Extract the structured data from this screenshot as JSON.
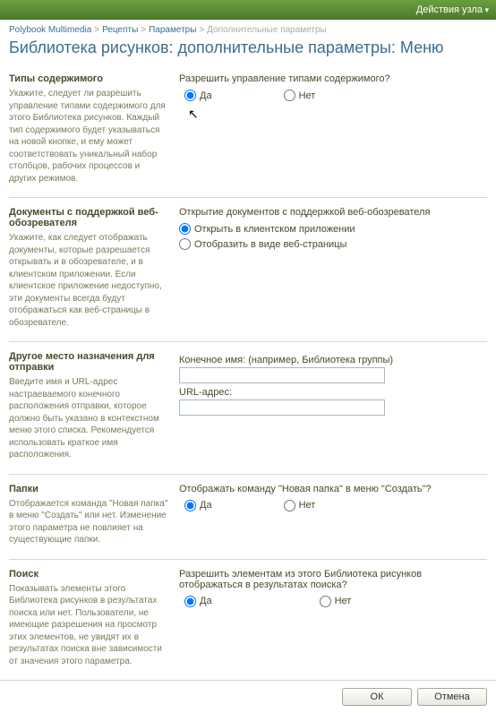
{
  "topbar": {
    "action": "Действия узла"
  },
  "breadcrumb": {
    "items": [
      "Polybook Multimedia",
      "Рецепты",
      "Параметры"
    ],
    "current": "Дополнительные параметры"
  },
  "title": "Библиотека рисунков: дополнительные параметры: Меню",
  "sections": {
    "contentTypes": {
      "heading": "Типы содержимого",
      "desc": "Укажите, следует ли разрешить управление типами содержимого для этого Библиотека рисунков. Каждый тип содержимого будет указываться на новой кнопке, и ему может соответствовать уникальный набор столбцов, рабочих процессов и других режимов.",
      "question": "Разрешить управление типами содержимого?",
      "yes": "Да",
      "no": "Нет"
    },
    "webDocs": {
      "heading": "Документы с поддержкой веб-обозревателя",
      "desc": "Укажите, как следует отображать документы, которые разрешается открывать и в обозревателе, и в клиентском приложении. Если клиентское приложение недоступно, эти документы всегда будут отображаться как веб-страницы в обозревателе.",
      "question": "Открытие документов с поддержкой веб-обозревателя",
      "opt1": "Открыть в клиентском приложении",
      "opt2": "Отобразить в виде веб-страницы"
    },
    "sendTo": {
      "heading": "Другое место назначения для отправки",
      "desc": "Введите имя и URL-адрес настраеваемого конечного расположения отправки, которое должно быть указано в контекстном меню этого списка. Рекомендуется использовать краткое имя расположения.",
      "nameLabel": "Конечное имя: (например, Библиотека группы)",
      "urlLabel": "URL-адрес:",
      "nameVal": "",
      "urlVal": ""
    },
    "folders": {
      "heading": "Папки",
      "desc": "Отображается команда \"Новая папка\" в меню \"Создать\" или нет. Изменение этого параметра не повлияет на существующие папки.",
      "question": "Отображать команду \"Новая папка\" в меню \"Создать\"?",
      "yes": "Да",
      "no": "Нет"
    },
    "search": {
      "heading": "Поиск",
      "desc": "Показывать элементы этого Библиотека рисунков в результатах поиска или нет. Пользователи, не имеющие разрешения на просмотр этих элементов, не увидят их в результатах поиска вне зависимости от значения этого параметра.",
      "question": "Разрешить элементам из этого Библиотека рисунков отображаться в результатах поиска?",
      "yes": "Да",
      "no": "Нет"
    }
  },
  "buttons": {
    "ok": "ОК",
    "cancel": "Отмена"
  }
}
